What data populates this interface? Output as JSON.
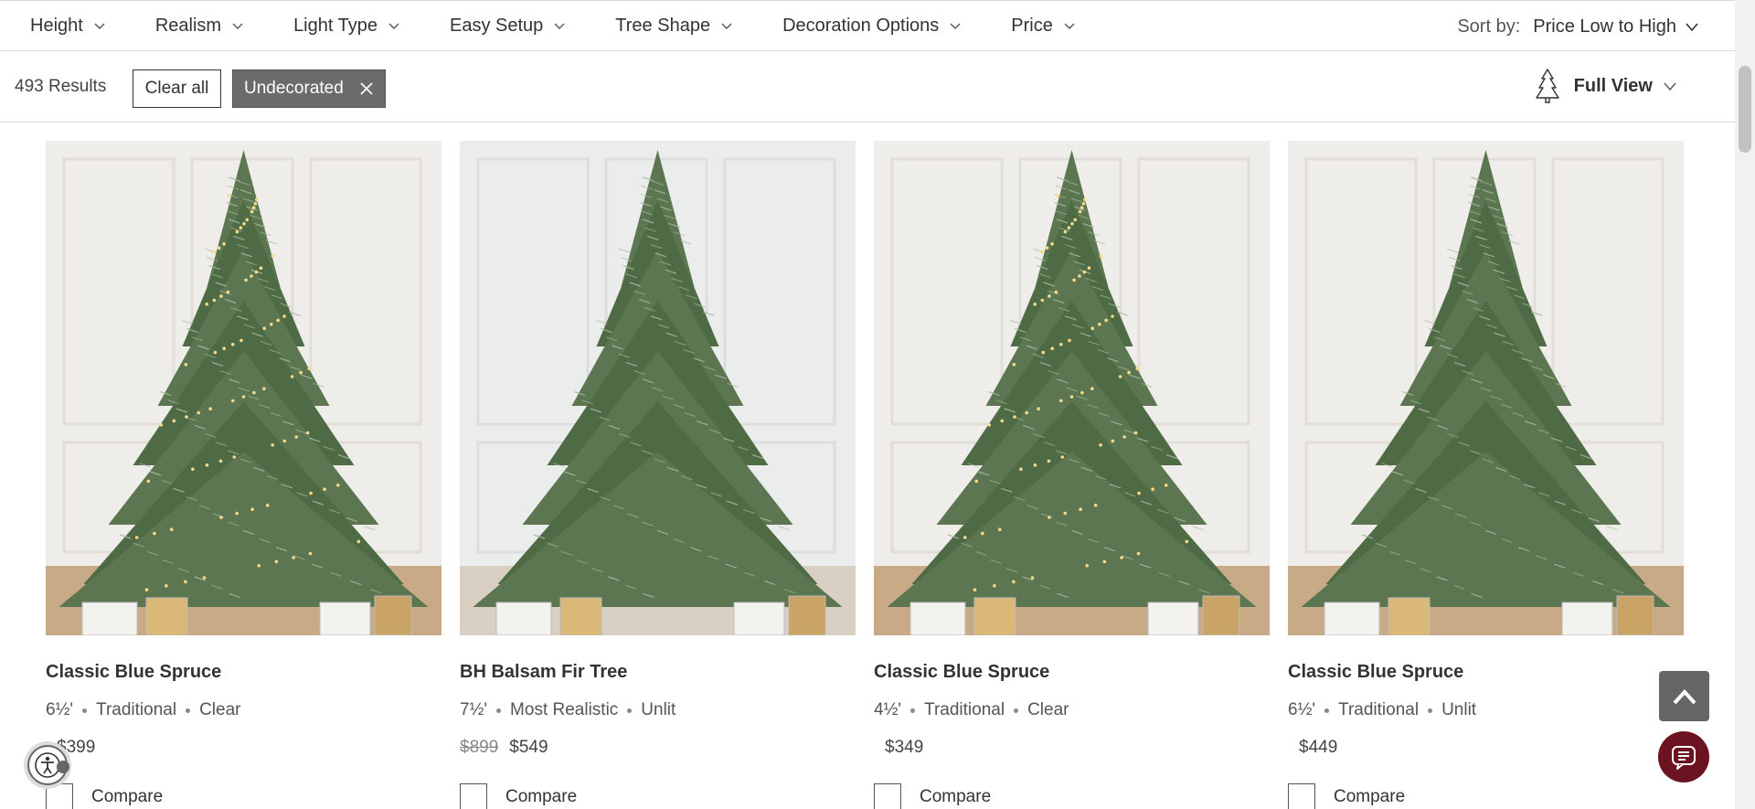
{
  "filters": [
    {
      "label": "Height"
    },
    {
      "label": "Realism"
    },
    {
      "label": "Light Type"
    },
    {
      "label": "Easy Setup"
    },
    {
      "label": "Tree Shape"
    },
    {
      "label": "Decoration Options"
    },
    {
      "label": "Price"
    }
  ],
  "sort": {
    "label": "Sort by:",
    "value": "Price Low to High"
  },
  "results": {
    "count_text": "493 Results",
    "clear_all": "Clear all",
    "active_chip": "Undecorated"
  },
  "view": {
    "label": "Full View"
  },
  "products": [
    {
      "name": "Classic Blue Spruce",
      "height": "6½'",
      "style": "Traditional",
      "light": "Clear",
      "price_was": "",
      "price": "$399",
      "compare": "Compare",
      "lit": true
    },
    {
      "name": "BH Balsam Fir Tree",
      "height": "7½'",
      "style": "Most Realistic",
      "light": "Unlit",
      "price_was": "$899",
      "price": "$549",
      "compare": "Compare",
      "lit": false
    },
    {
      "name": "Classic Blue Spruce",
      "height": "4½'",
      "style": "Traditional",
      "light": "Clear",
      "price_was": "",
      "price": "$349",
      "compare": "Compare",
      "lit": true
    },
    {
      "name": "Classic Blue Spruce",
      "height": "6½'",
      "style": "Traditional",
      "light": "Unlit",
      "price_was": "",
      "price": "$449",
      "compare": "Compare",
      "lit": false
    }
  ],
  "colors": {
    "chip_bg": "#6b6b6b",
    "chat_bg": "#6b1320",
    "to_top_bg": "#666666",
    "tree_green": "#4f6b45"
  }
}
